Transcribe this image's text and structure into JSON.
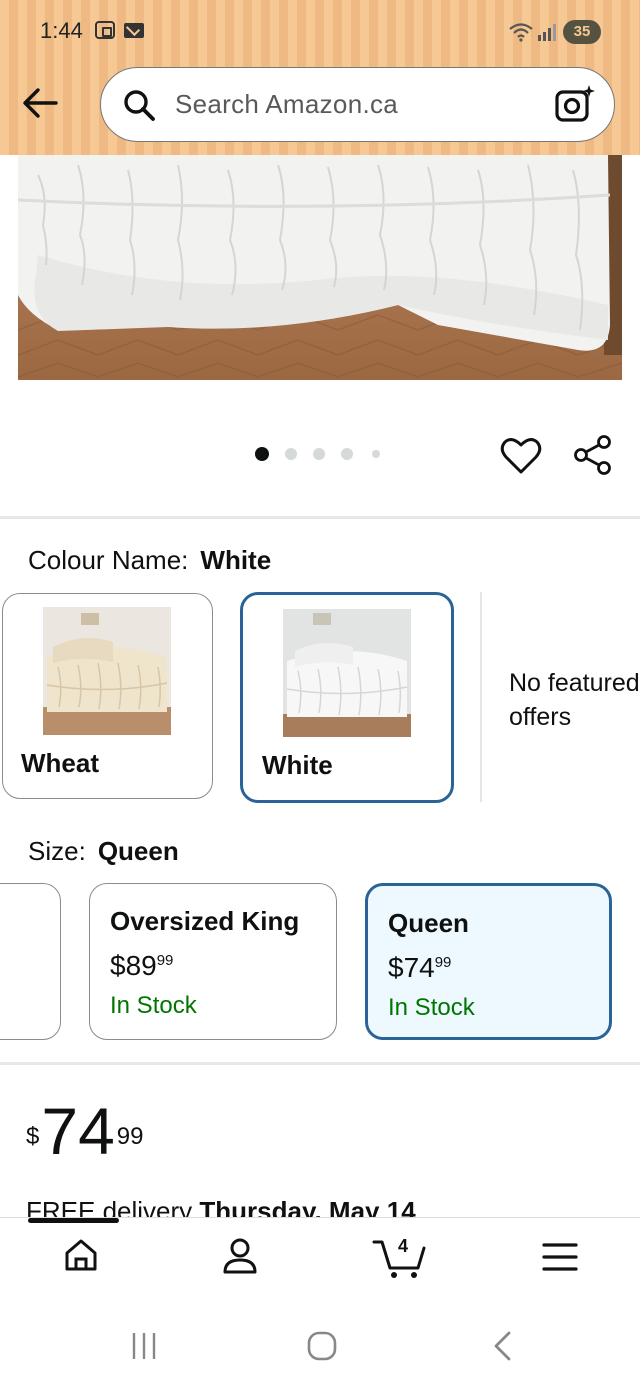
{
  "status_bar": {
    "time": "1:44",
    "battery": "35"
  },
  "search": {
    "placeholder": "Search Amazon.ca"
  },
  "gallery": {
    "image_count": 5,
    "active_index": 0
  },
  "colour": {
    "label": "Colour Name:",
    "selected": "White",
    "options": [
      {
        "name": "Wheat",
        "selected": false
      },
      {
        "name": "White",
        "selected": true
      }
    ],
    "no_featured": "No featured offers"
  },
  "size": {
    "label": "Size:",
    "selected": "Queen",
    "options": [
      {
        "name": "Oversized King",
        "price_dollars": "$89",
        "price_cents": "99",
        "stock": "In Stock",
        "selected": false
      },
      {
        "name": "Queen",
        "price_dollars": "$74",
        "price_cents": "99",
        "stock": "In Stock",
        "selected": true
      }
    ]
  },
  "price": {
    "currency": "$",
    "dollars": "74",
    "cents": "99"
  },
  "delivery": {
    "prefix": "FREE delivery",
    "date": "Thursday, May 14"
  },
  "bottom_nav": {
    "items": [
      "home",
      "account",
      "cart",
      "menu"
    ],
    "active": "home",
    "cart_count": "4"
  },
  "colors": {
    "selected_border": "#2a6496",
    "selected_fill": "#edf8ff",
    "in_stock": "#007600",
    "header_bg": "#f5c894"
  }
}
